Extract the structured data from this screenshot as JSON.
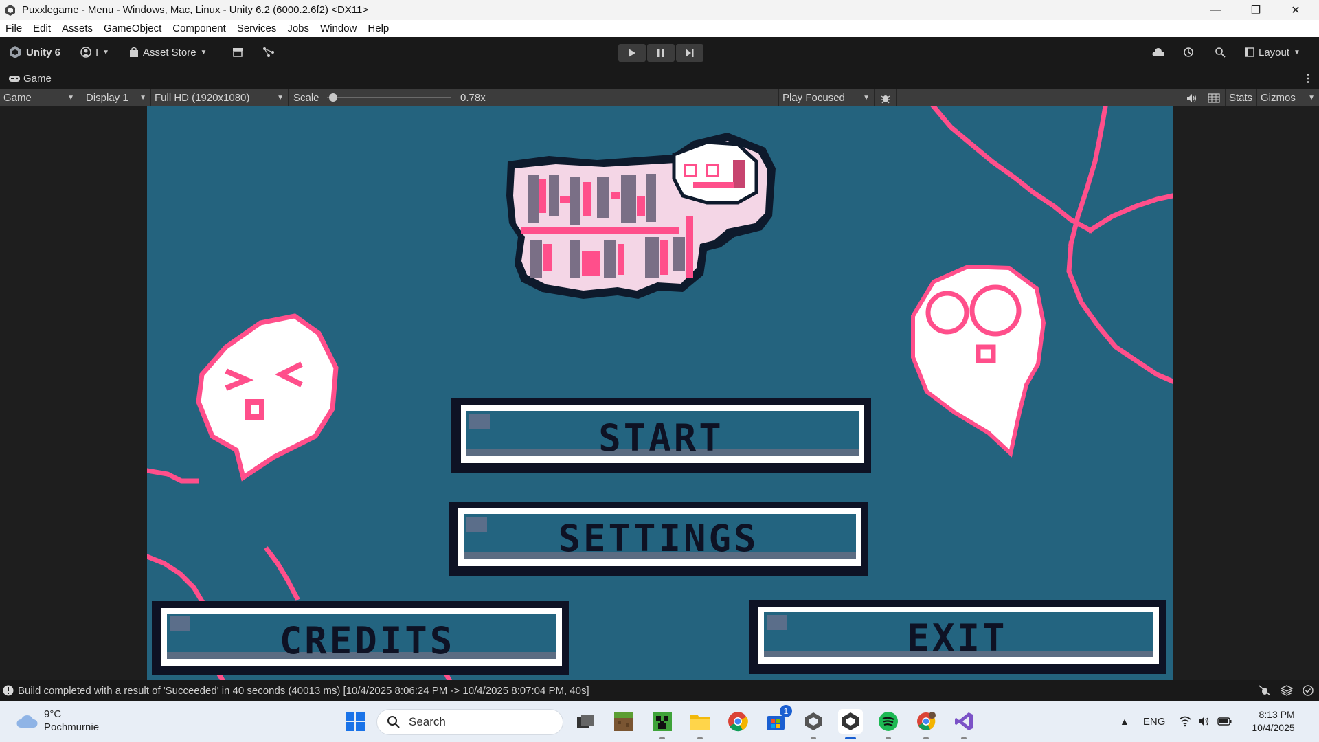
{
  "window": {
    "title": "Puxxlegame - Menu - Windows, Mac, Linux - Unity 6.2 (6000.2.6f2) <DX11>",
    "minimize": "—",
    "restore": "❐",
    "close": "✕"
  },
  "menubar": [
    "File",
    "Edit",
    "Assets",
    "GameObject",
    "Component",
    "Services",
    "Jobs",
    "Window",
    "Help"
  ],
  "toolbar": {
    "unity_label": "Unity 6",
    "account_label": "I",
    "asset_store_label": "Asset Store",
    "layout_label": "Layout"
  },
  "tab": {
    "game_label": "Game"
  },
  "gamebar": {
    "view_mode": "Game",
    "display": "Display 1",
    "resolution": "Full HD (1920x1080)",
    "scale_label": "Scale",
    "scale_value": "0.78x",
    "scale_fraction": 0.05,
    "play_mode": "Play Focused",
    "stats_label": "Stats",
    "gizmos_label": "Gizmos"
  },
  "game": {
    "buttons": {
      "start": "START",
      "settings": "SETTINGS",
      "credits": "CREDITS",
      "exit": "EXIT"
    },
    "colors": {
      "background": "#24637e",
      "accent_pink": "#ff4f8b",
      "button_dark": "#0e1224"
    }
  },
  "status": {
    "message": "Build completed with a result of 'Succeeded' in 40 seconds (40013 ms) [10/4/2025 8:06:24 PM -> 10/4/2025 8:07:04 PM, 40s]"
  },
  "taskbar": {
    "weather_temp": "9°C",
    "weather_desc": "Pochmurnie",
    "search_placeholder": "Search",
    "language": "ENG",
    "time": "8:13 PM",
    "date": "10/4/2025",
    "notification_badge": "1"
  }
}
